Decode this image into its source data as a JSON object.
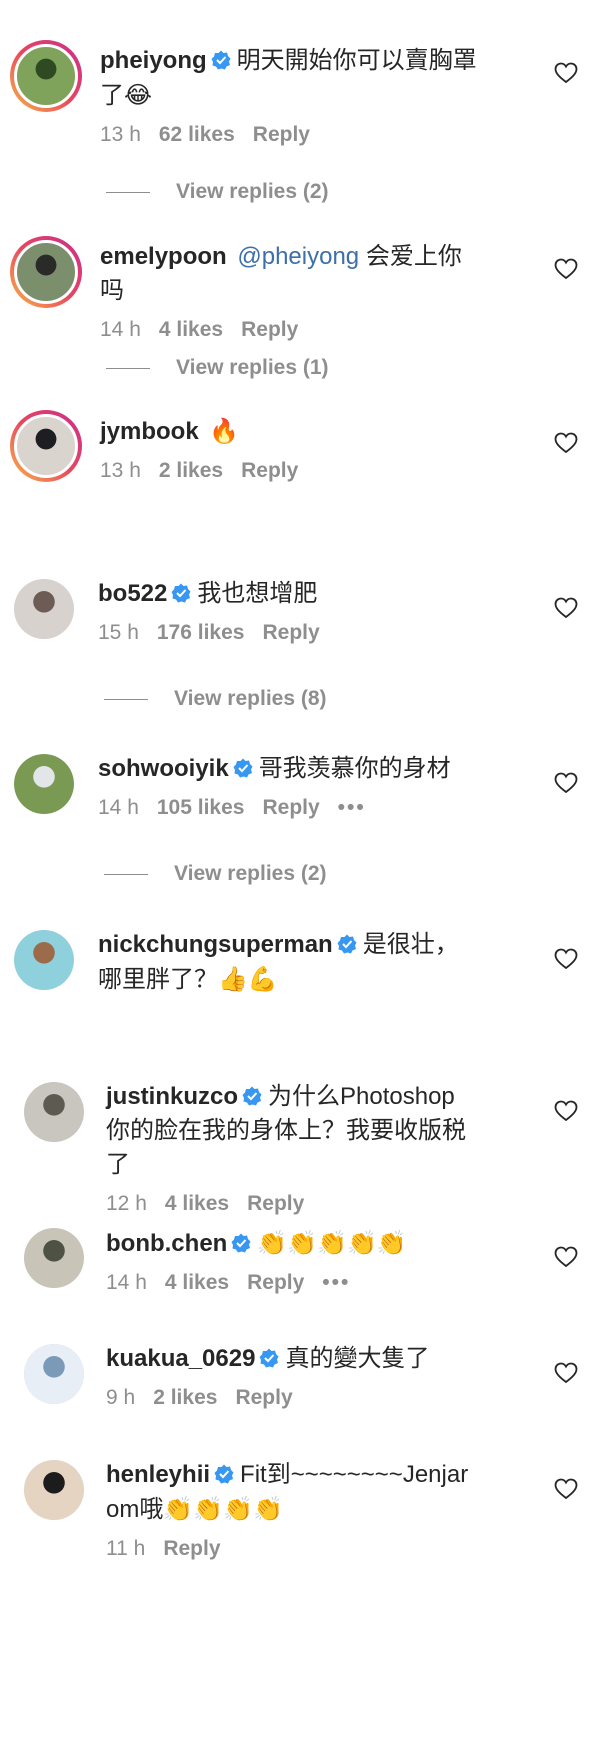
{
  "comments": [
    {
      "username": "pheiyong",
      "verified": true,
      "mention": "",
      "text": "明天開始你可以賣胸罩了",
      "emoji": "😂",
      "time": "13 h",
      "likes": "62 likes",
      "reply": "Reply",
      "more": "",
      "view_replies": "View replies (2)",
      "avatar_colors": [
        "#7fa35a",
        "#2f4a22"
      ]
    },
    {
      "username": "emelypoon",
      "verified": false,
      "mention": "@pheiyong",
      "text": "会爱上你吗",
      "emoji": "",
      "time": "14 h",
      "likes": "4 likes",
      "reply": "Reply",
      "more": "",
      "view_replies": "View replies (1)",
      "avatar_colors": [
        "#7c8f6d",
        "#2a2a28"
      ]
    },
    {
      "username": "jymbook",
      "verified": false,
      "mention": "",
      "text": "",
      "emoji": "🔥",
      "time": "13 h",
      "likes": "2 likes",
      "reply": "Reply",
      "more": "",
      "view_replies": "",
      "avatar_colors": [
        "#d9d4cd",
        "#1e1e22"
      ]
    },
    {
      "username": "bo522",
      "verified": true,
      "mention": "",
      "text": "我也想增肥",
      "emoji": "",
      "time": "15 h",
      "likes": "176 likes",
      "reply": "Reply",
      "more": "",
      "view_replies": "View replies (8)",
      "avatar_colors": [
        "#d8d2cf",
        "#6d5b55"
      ]
    },
    {
      "username": "sohwooiyik",
      "verified": true,
      "mention": "",
      "text": "哥我羡慕你的身材",
      "emoji": "",
      "time": "14 h",
      "likes": "105 likes",
      "reply": "Reply",
      "more": "•••",
      "view_replies": "View replies (2)",
      "avatar_colors": [
        "#7a9a54",
        "#e3e6e8"
      ]
    },
    {
      "username": "nickchungsuperman",
      "verified": true,
      "mention": "",
      "text": "是很壮，哪里胖了？",
      "emoji": "👍💪",
      "time": "",
      "likes": "",
      "reply": "",
      "more": "",
      "view_replies": "",
      "avatar_colors": [
        "#8fd0dd",
        "#9b6b4a"
      ]
    },
    {
      "username": "justinkuzco",
      "verified": true,
      "mention": "",
      "text": "为什么Photoshop你的脸在我的身体上？我要收版税了",
      "emoji": "",
      "time": "12 h",
      "likes": "4 likes",
      "reply": "Reply",
      "more": "",
      "view_replies": "",
      "avatar_colors": [
        "#c9c6bf",
        "#5d5a52"
      ]
    },
    {
      "username": "bonb.chen",
      "verified": true,
      "mention": "",
      "text": "",
      "emoji": "👏👏👏👏👏",
      "time": "14 h",
      "likes": "4 likes",
      "reply": "Reply",
      "more": "•••",
      "view_replies": "",
      "avatar_colors": [
        "#c8c4b7",
        "#4e5244"
      ]
    },
    {
      "username": "kuakua_0629",
      "verified": true,
      "mention": "",
      "text": "真的變大隻了",
      "emoji": "",
      "time": "9 h",
      "likes": "2 likes",
      "reply": "Reply",
      "more": "",
      "view_replies": "",
      "avatar_colors": [
        "#e8eef5",
        "#7a9ab8"
      ]
    },
    {
      "username": "henleyhii",
      "verified": true,
      "mention": "",
      "text": "Fit到~~~~~~~~Jenjarom哦",
      "emoji": "👏👏👏👏",
      "time": "11 h",
      "likes": "",
      "reply": "Reply",
      "more": "",
      "view_replies": "",
      "avatar_colors": [
        "#e6d4c2",
        "#1c1c1c"
      ]
    }
  ],
  "colors": {
    "verified_blue": "#3897f0",
    "muted_text": "#8e8e8e",
    "mention_blue": "#3d6fa8"
  },
  "icons": {
    "verified": "verified-badge-icon",
    "like": "heart-outline-icon"
  }
}
